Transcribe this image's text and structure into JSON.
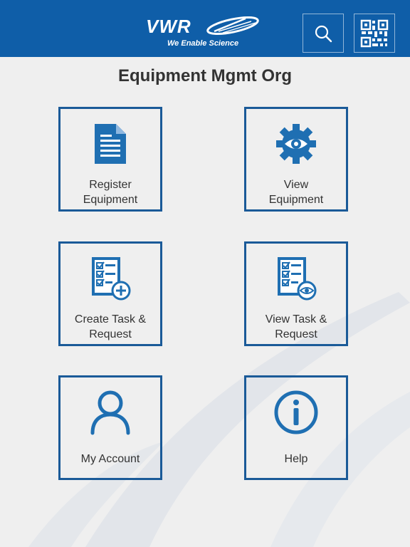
{
  "header": {
    "logo_text": "VWR",
    "logo_tagline": "We Enable Science",
    "search_icon": "search-icon",
    "qr_icon": "qr-code-icon",
    "background_color": "#0f5ea8"
  },
  "page": {
    "title": "Equipment Mgmt Org"
  },
  "tiles": [
    {
      "line1": "Register",
      "line2": "Equipment",
      "icon": "document-icon"
    },
    {
      "line1": "View",
      "line2": "Equipment",
      "icon": "gear-eye-icon"
    },
    {
      "line1": "Create Task &",
      "line2": "Request",
      "icon": "checklist-add-icon"
    },
    {
      "line1": "View Task &",
      "line2": "Request",
      "icon": "checklist-view-icon"
    },
    {
      "line1": "My Account",
      "icon": "user-icon"
    },
    {
      "line1": "Help",
      "icon": "info-icon"
    }
  ],
  "colors": {
    "brand_blue": "#0f5ea8",
    "tile_border": "#1a5a98",
    "icon_blue": "#1f6fb2",
    "background": "#efefef"
  }
}
